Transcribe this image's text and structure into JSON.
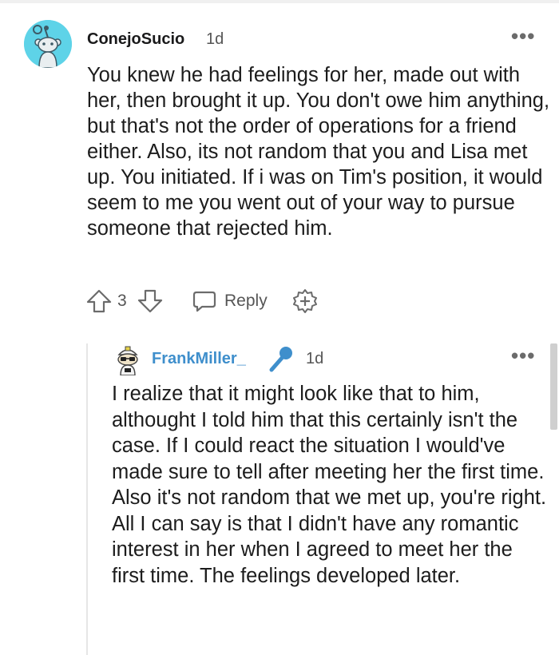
{
  "comment": {
    "username": "ConejoSucio",
    "time": "1d",
    "more_label": "•••",
    "body": "You knew he had feelings for her, made out with her, then brought it up. You don't owe him anything, but that's not the order of operations for a friend either. Also, its not random that you and Lisa met up. You initiated. If i was on Tim's position, it would seem to me you went out of your way to pursue someone that rejected him.",
    "score": "3",
    "reply_label": "Reply",
    "icons": {
      "upvote": "upvote-icon",
      "downvote": "downvote-icon",
      "reply": "reply-bubble-icon",
      "award": "award-plus-icon",
      "avatar": "snoo-avatar"
    }
  },
  "reply": {
    "username": "FrankMiller_",
    "time": "1d",
    "more_label": "•••",
    "flair_icon": "microphone-icon",
    "paragraphs": [
      "I realize that it might look like that to him, althought I told him that this certainly isn't the case. If I could react the situation I would've made sure to tell after meeting her the first time.",
      "Also it's not random that we met up, you're right. All I can say is that I didn't have any romantic interest in her when I agreed to meet her the first time. The feelings developed later."
    ]
  },
  "colors": {
    "avatar_bg": "#5ed3e8",
    "reply_username": "#3f8fcc",
    "mic": "#3f8fcc",
    "icon_gray": "#6b6b6b"
  }
}
